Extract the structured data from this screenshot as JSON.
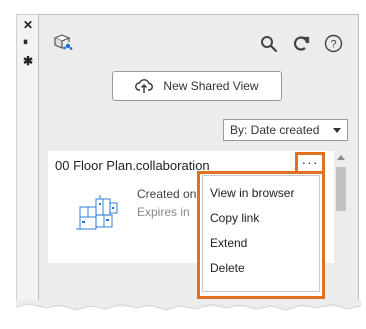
{
  "side_strip": {
    "close_glyph": "✕",
    "pin_glyph": "⏸",
    "settings_glyph": "✱"
  },
  "toolbar": {
    "logo_icon": "shared-views-icon",
    "search_icon": "search-icon",
    "refresh_icon": "refresh-icon",
    "help_icon": "help-icon"
  },
  "new_button": {
    "label": "New Shared View",
    "icon": "cloud-upload-icon"
  },
  "sort": {
    "selected": "By: Date created"
  },
  "card": {
    "title": "00 Floor Plan.collaboration",
    "created": "Created on",
    "expires": "Expires in"
  },
  "more_button": {
    "label": "···"
  },
  "menu": {
    "items": [
      {
        "label": "View in browser"
      },
      {
        "label": "Copy link"
      },
      {
        "label": "Extend"
      },
      {
        "label": "Delete"
      }
    ]
  },
  "colors": {
    "highlight": "#e0711f",
    "panel_bg": "#ececec",
    "accent_blue": "#1a73d9"
  }
}
